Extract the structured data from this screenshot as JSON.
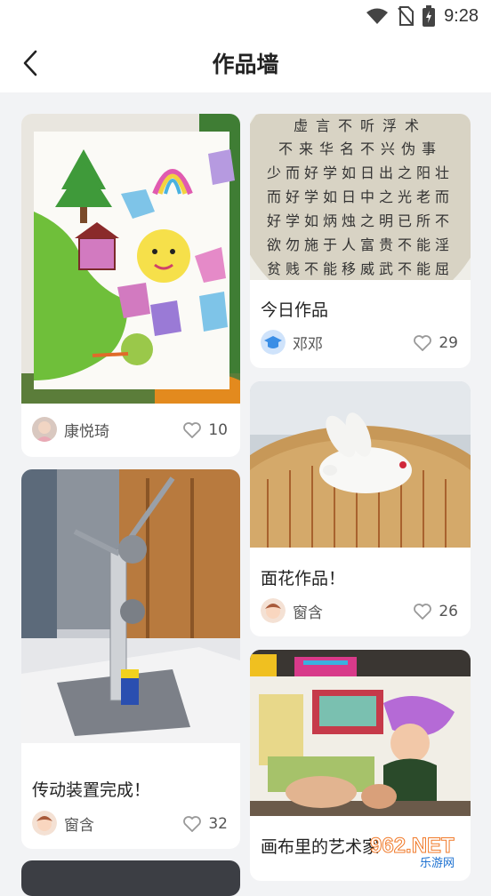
{
  "status": {
    "time": "9:28"
  },
  "header": {
    "title": "作品墙"
  },
  "cards": [
    {
      "caption": "",
      "user": "康悦琦",
      "likes": "10"
    },
    {
      "caption": "今日作品",
      "user": "邓邓",
      "likes": "29"
    },
    {
      "caption": "传动装置完成！",
      "user": "窗含",
      "likes": "32"
    },
    {
      "caption": "面花作品！",
      "user": "窗含",
      "likes": "26"
    },
    {
      "caption": "画布里的艺术家",
      "user": "",
      "likes": ""
    }
  ],
  "calligraphy": {
    "title_row": "虚言不听浮术",
    "rows": [
      "不来华名不兴伪事",
      "少而好学如日出之阳壮",
      "而好学如日中之光老而",
      "好学如炳烛之明已所不",
      "欲勿施于人富贵不能淫",
      "贫贱不能移威武不能屈"
    ]
  },
  "watermark": {
    "brand": "962.NET",
    "sub": "乐游网"
  },
  "colors": {
    "heart": "#999999",
    "accent": "#3a8ee6"
  }
}
